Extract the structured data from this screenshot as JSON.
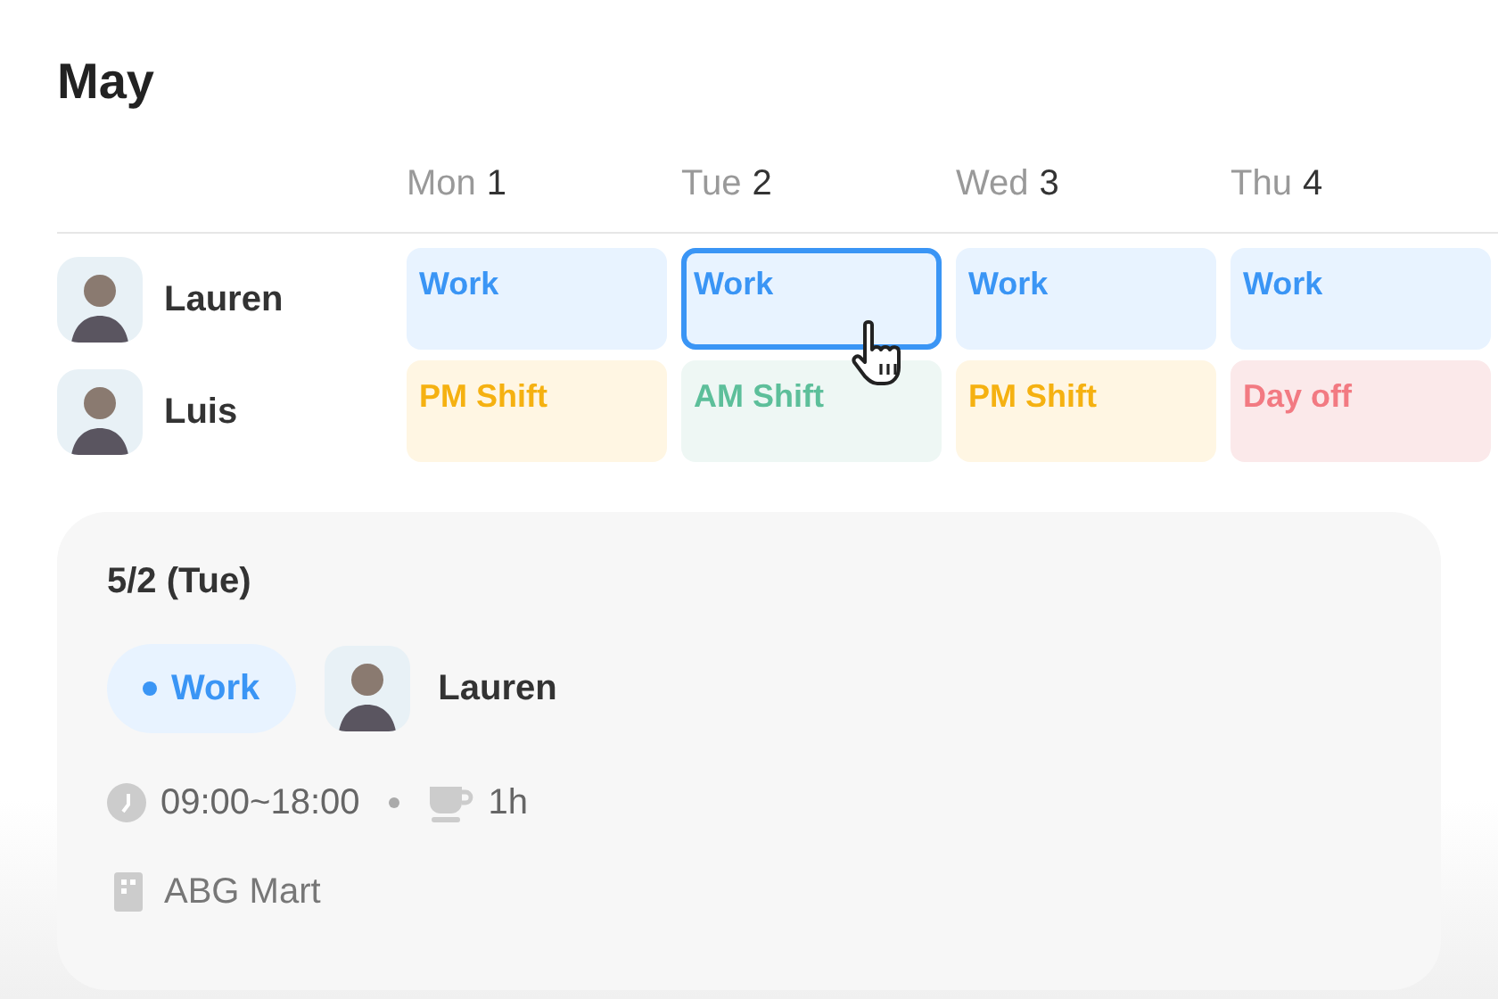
{
  "title": "May",
  "days": [
    {
      "name": "Mon",
      "num": "1"
    },
    {
      "name": "Tue",
      "num": "2"
    },
    {
      "name": "Wed",
      "num": "3"
    },
    {
      "name": "Thu",
      "num": "4"
    }
  ],
  "people": [
    {
      "name": "Lauren",
      "shifts": [
        {
          "label": "Work",
          "kind": "work",
          "selected": false
        },
        {
          "label": "Work",
          "kind": "work",
          "selected": true
        },
        {
          "label": "Work",
          "kind": "work",
          "selected": false
        },
        {
          "label": "Work",
          "kind": "work",
          "selected": false
        }
      ]
    },
    {
      "name": "Luis",
      "shifts": [
        {
          "label": "PM Shift",
          "kind": "pm",
          "selected": false
        },
        {
          "label": "AM Shift",
          "kind": "am",
          "selected": false
        },
        {
          "label": "PM Shift",
          "kind": "pm",
          "selected": false
        },
        {
          "label": "Day off",
          "kind": "off",
          "selected": false
        }
      ]
    }
  ],
  "detail": {
    "date": "5/2 (Tue)",
    "tag": {
      "label": "Work",
      "kind": "work"
    },
    "person": "Lauren",
    "time": "09:00~18:00",
    "break": "1h",
    "place": "ABG Mart"
  }
}
